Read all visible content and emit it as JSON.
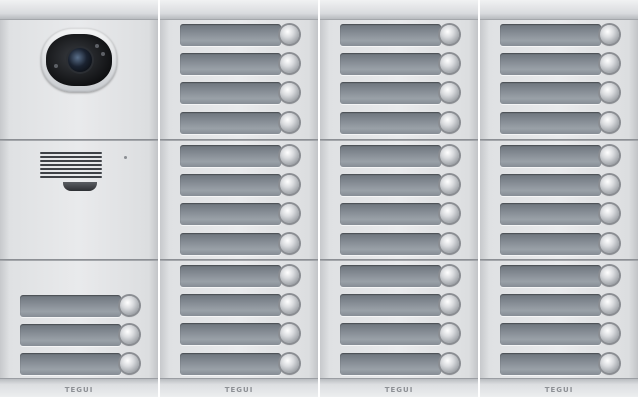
{
  "brand_label": "TEGUI",
  "panels": [
    {
      "type": "intercom",
      "brand": "TEGUI"
    },
    {
      "type": "buttons",
      "brand": "TEGUI"
    },
    {
      "type": "buttons",
      "brand": "TEGUI"
    },
    {
      "type": "buttons",
      "brand": "TEGUI"
    }
  ],
  "icons": {
    "camera": "camera-icon",
    "speaker": "speaker-grille-icon",
    "microphone": "microphone-icon",
    "call_button": "round-push-button"
  },
  "colors": {
    "panel": "#e6e7e9",
    "label_strip": "#858c94",
    "button": "#d9dbde",
    "camera_window": "#111214"
  }
}
